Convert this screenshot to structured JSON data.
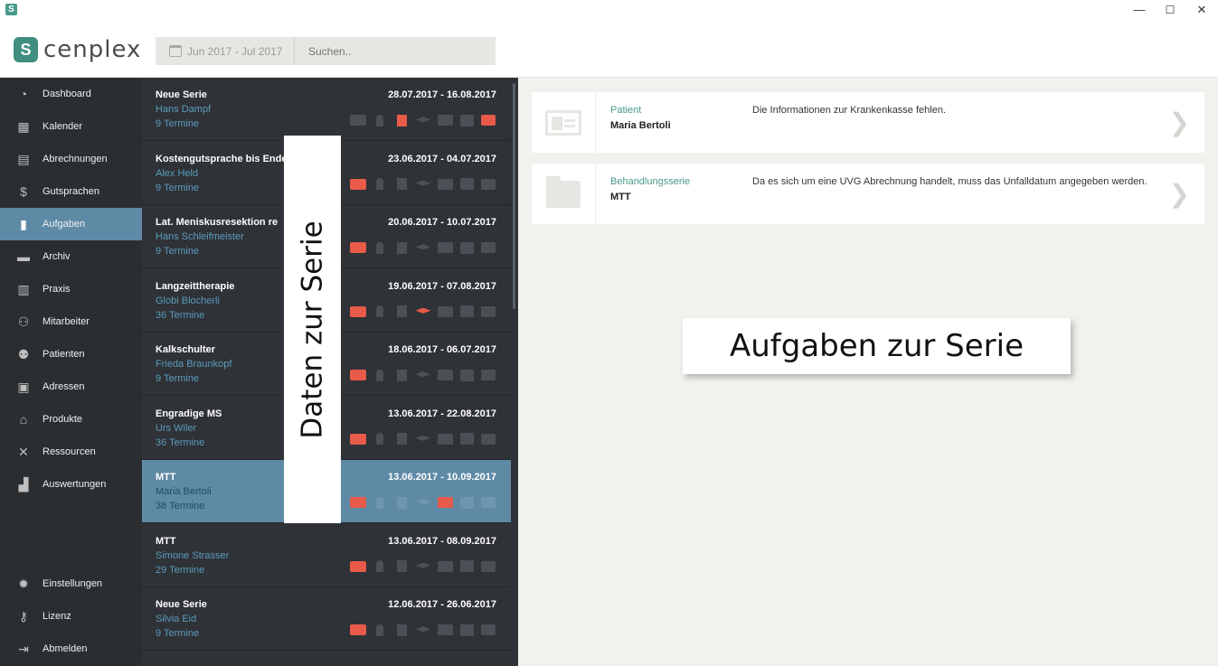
{
  "window": {
    "minimize": "—",
    "maximize": "☐",
    "close": "✕"
  },
  "header": {
    "logo_text": "cenplex",
    "date_range": "Jun 2017 - Jul 2017",
    "search_placeholder": "Suchen.."
  },
  "sidebar": {
    "items": [
      {
        "label": "Dashboard",
        "icon": "dashboard-icon"
      },
      {
        "label": "Kalender",
        "icon": "calendar-icon"
      },
      {
        "label": "Abrechnungen",
        "icon": "calculator-icon"
      },
      {
        "label": "Gutsprachen",
        "icon": "dollar-icon"
      },
      {
        "label": "Aufgaben",
        "icon": "clipboard-icon",
        "active": true
      },
      {
        "label": "Archiv",
        "icon": "archive-icon"
      },
      {
        "label": "Praxis",
        "icon": "building-icon"
      },
      {
        "label": "Mitarbeiter",
        "icon": "team-icon"
      },
      {
        "label": "Patienten",
        "icon": "patients-icon"
      },
      {
        "label": "Adressen",
        "icon": "address-book-icon"
      },
      {
        "label": "Produkte",
        "icon": "store-icon"
      },
      {
        "label": "Ressourcen",
        "icon": "tools-icon"
      },
      {
        "label": "Auswertungen",
        "icon": "stats-icon"
      }
    ],
    "bottom": [
      {
        "label": "Einstellungen",
        "icon": "gear-icon"
      },
      {
        "label": "Lizenz",
        "icon": "key-icon"
      },
      {
        "label": "Abmelden",
        "icon": "logout-icon"
      }
    ]
  },
  "series": [
    {
      "title": "Neue Serie",
      "patient": "Hans Dampf",
      "termine": "9 Termine",
      "dates": "28.07.2017 - 16.08.2017",
      "red": [
        false,
        false,
        true,
        false,
        false,
        false,
        true
      ]
    },
    {
      "title": "Kostengutsprache bis Ende J",
      "patient": "Alex Held",
      "termine": "9 Termine",
      "dates": "23.06.2017 - 04.07.2017",
      "red": [
        true,
        false,
        false,
        false,
        false,
        false,
        false
      ]
    },
    {
      "title": "Lat. Meniskusresektion re",
      "patient": "Hans Schleifmeister",
      "termine": "9 Termine",
      "dates": "20.06.2017 - 10.07.2017",
      "red": [
        true,
        false,
        false,
        false,
        false,
        false,
        false
      ]
    },
    {
      "title": "Langzeittherapie",
      "patient": "Globi Blocherli",
      "termine": "36 Termine",
      "dates": "19.06.2017 - 07.08.2017",
      "red": [
        true,
        false,
        false,
        true,
        false,
        false,
        false
      ]
    },
    {
      "title": "Kalkschulter",
      "patient": "Frieda Braunkopf",
      "termine": "9 Termine",
      "dates": "18.06.2017 - 06.07.2017",
      "red": [
        true,
        false,
        false,
        false,
        false,
        false,
        false
      ]
    },
    {
      "title": "Engradige MS",
      "patient": "Urs Wiler",
      "termine": "36 Termine",
      "dates": "13.06.2017 - 22.08.2017",
      "red": [
        true,
        false,
        false,
        false,
        false,
        false,
        false
      ]
    },
    {
      "title": "MTT",
      "patient": "Maria Bertoli",
      "termine": "38 Termine",
      "dates": "13.06.2017 - 10.09.2017",
      "active": true,
      "red": [
        true,
        false,
        false,
        false,
        true,
        false,
        false
      ]
    },
    {
      "title": "MTT",
      "patient": "Simone Strasser",
      "termine": "29 Termine",
      "dates": "13.06.2017 - 08.09.2017",
      "red": [
        true,
        false,
        false,
        false,
        false,
        false,
        false
      ]
    },
    {
      "title": "Neue Serie",
      "patient": "Silvia Eid",
      "termine": "9 Termine",
      "dates": "12.06.2017 - 26.06.2017",
      "red": [
        true,
        false,
        false,
        false,
        false,
        false,
        false
      ]
    }
  ],
  "overlay_left": "Daten zur Serie",
  "overlay_right": "Aufgaben zur Serie",
  "tasks": [
    {
      "label": "Patient",
      "value": "Maria Bertoli",
      "message": "Die Informationen zur Krankenkasse fehlen.",
      "icon": "id-card-icon"
    },
    {
      "label": "Behandlungsserie",
      "value": "MTT",
      "message": "Da es sich um eine UVG Abrechnung handelt, muss das Unfalldatum angegeben werden.",
      "icon": "folder-icon"
    }
  ],
  "colors": {
    "accent": "#5f8aa6",
    "alert": "#e85a4a",
    "brand": "#3f8e80",
    "sidebar_bg": "#2b2e31"
  }
}
